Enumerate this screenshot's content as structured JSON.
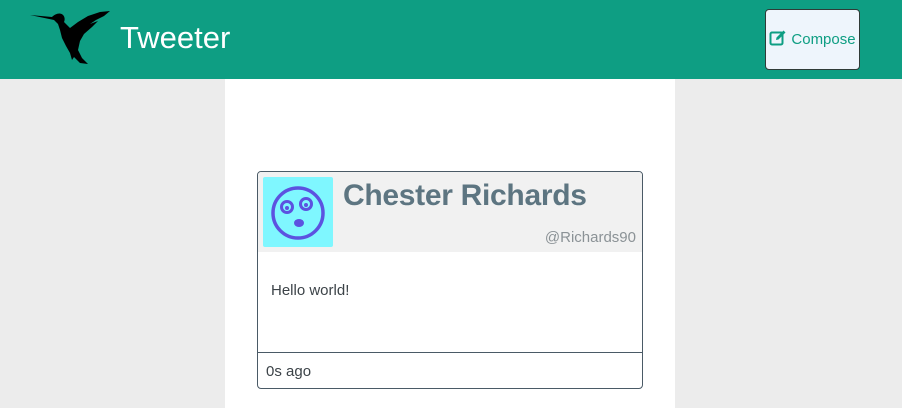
{
  "app": {
    "brand": "Tweeter",
    "logo_icon": "hummingbird-icon",
    "accent_color": "#0e9e83"
  },
  "navbar": {
    "compose_label": "Compose",
    "compose_icon": "edit-icon"
  },
  "tweets": [
    {
      "name": "Chester Richards",
      "handle": "@Richards90",
      "text": "Hello world!",
      "time": "0s ago",
      "avatar_icon": "surprised-face-avatar-icon",
      "avatar_bg": "#7ff7ff"
    }
  ]
}
